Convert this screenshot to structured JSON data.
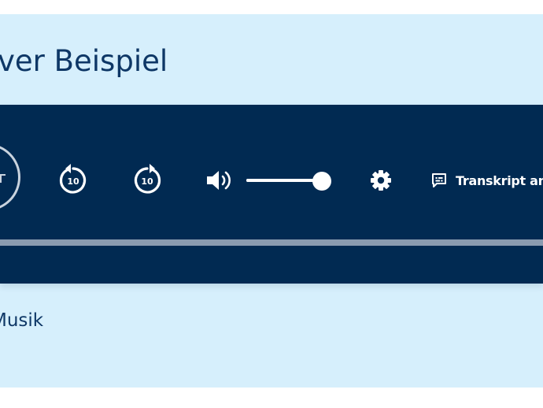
{
  "card": {
    "title": "ver Beispiel",
    "meta_text": "Musik"
  },
  "player": {
    "controls": {
      "rewind_seconds": "10",
      "forward_seconds": "10",
      "volume_level": 1.0,
      "transcript_label": "Transkript an"
    },
    "progress": 0.0
  },
  "colors": {
    "card_background": "#d6effc",
    "player_background": "#012a52",
    "title_text": "#0e3766",
    "control_icons": "#ffffff",
    "progress_track": "#8a9bb0"
  },
  "icons": [
    "play-icon",
    "rewind-10-icon",
    "forward-10-icon",
    "volume-icon",
    "gear-icon",
    "transcript-icon"
  ]
}
